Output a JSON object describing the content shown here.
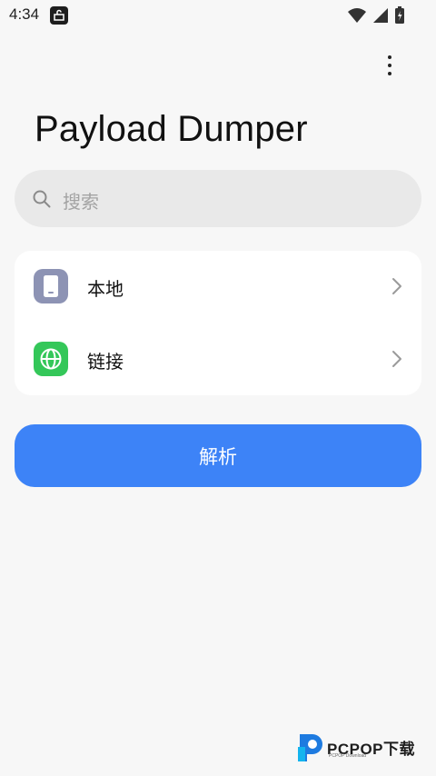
{
  "status_bar": {
    "time": "4:34"
  },
  "app": {
    "title": "Payload Dumper"
  },
  "search": {
    "placeholder": "搜索"
  },
  "source_list": {
    "items": [
      {
        "label": "本地",
        "icon": "phone-icon",
        "icon_bg": "#8d93b4"
      },
      {
        "label": "链接",
        "icon": "globe-icon",
        "icon_bg": "#34c759"
      }
    ]
  },
  "actions": {
    "parse_label": "解析",
    "parse_color": "#3d83f7"
  },
  "watermark": {
    "brand": "PCPOP下载",
    "sub": "PCPOP Download"
  }
}
